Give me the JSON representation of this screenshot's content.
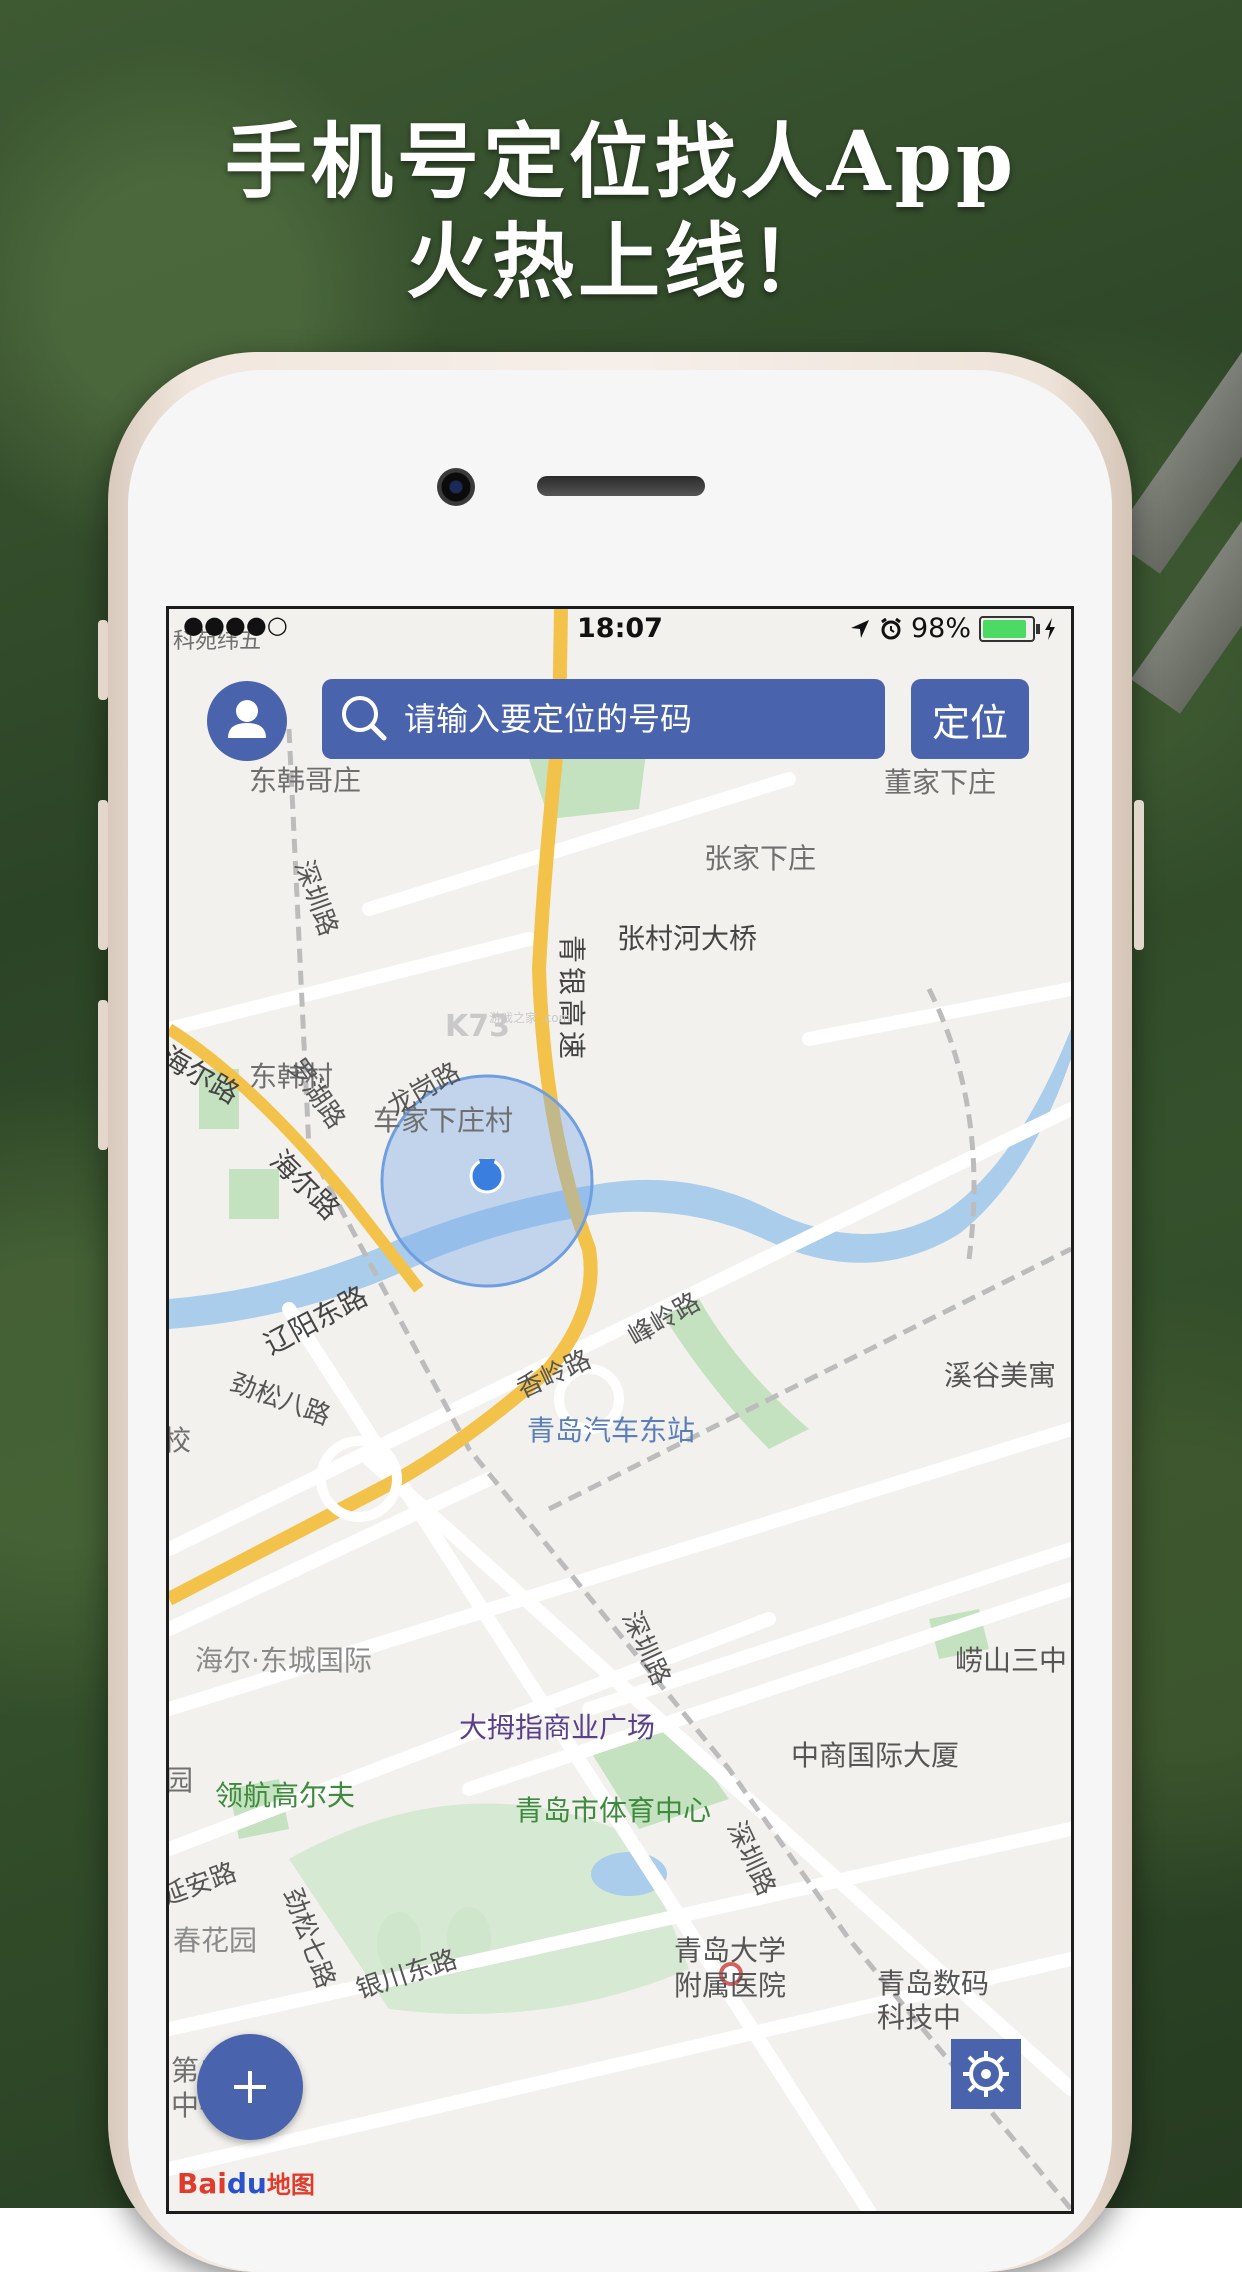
{
  "headline": {
    "line1": "手机号定位找人App",
    "line2": "火热上线！"
  },
  "status_bar": {
    "carrier": "●●●●○",
    "time": "18:07",
    "battery": "98%",
    "battery_level": 0.98
  },
  "header": {
    "search_placeholder": "请输入要定位的号码",
    "locate_label": "定位"
  },
  "map": {
    "places": {
      "donghangezhuang": "东韩哥庄",
      "dongjiaxiazhuang": "董家下庄",
      "zhangjiaxiazhuang": "张家下庄",
      "zhangcunhe_bridge": "张村河大桥",
      "dongguncun": "东韩村",
      "chejiaxiazhuang": "车家下庄村",
      "xigu": "溪谷美寓",
      "qingdao_bus_station": "青岛汽车东站",
      "haier_dongcheng": "海尔·东城国际",
      "damuzhi_plaza": "大拇指商业广场",
      "laoshan_sanzhong": "崂山三中",
      "zhongshang_tower": "中商国际大厦",
      "linghang_golf": "领航高尔夫",
      "qingdao_sports_center": "青岛市体育中心",
      "chunhua_garden": "春花园",
      "hospital_line1": "青岛大学",
      "hospital_line2": "附属医院",
      "digital_tech_line1": "青岛数码",
      "digital_tech_line2": "科技中",
      "kemao": "科苑纬五",
      "di_er": "第二",
      "xue": "中学",
      "xiao": "校",
      "yuan": "园"
    },
    "roads": {
      "shenzhen_road_1": "深圳路",
      "qingyin_expressway": "青银高速",
      "haier_road_1": "海尔路",
      "haier_road_2": "海尔路",
      "luohu_road": "罗湖路",
      "longgang_road": "龙岗路",
      "liaoyang_east": "辽阳东路",
      "jinsong_8": "劲松八路",
      "xiangling_road": "香岭路",
      "fengling_road": "峰岭路",
      "shenzhen_road_2": "深圳路",
      "shenzhen_road_3": "深圳路",
      "yinchuan_east": "银川东路",
      "jinsong_7": "劲松七路",
      "yanan_road": "延安路"
    }
  },
  "watermark": "K73",
  "watermark_sub": "游戏之家 .com",
  "baidu": {
    "bai": "Bai",
    "du": "du",
    "map": "地图"
  },
  "colors": {
    "accent": "#4a63ad",
    "water": "#a9cdea",
    "highway": "#f3c24a",
    "park": "#c4e2bf"
  }
}
